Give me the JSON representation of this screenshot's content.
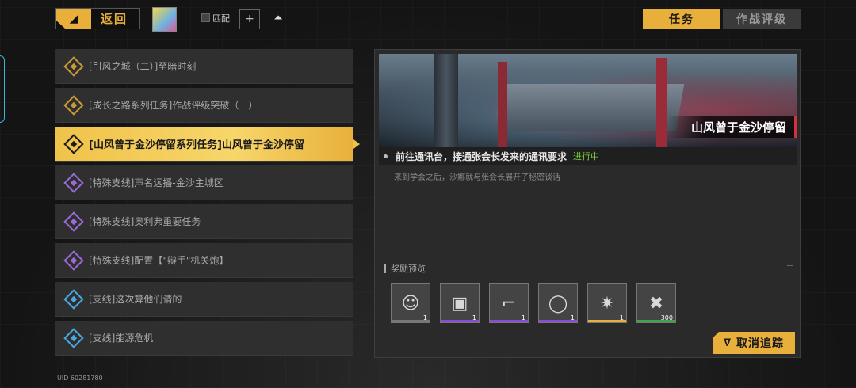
{
  "topbar": {
    "back_label": "返回",
    "back_arrow": "◢",
    "match_label": "匹配",
    "plus_label": "+",
    "up_icon": "⏶"
  },
  "tabs": [
    {
      "label": "任务",
      "active": true
    },
    {
      "label": "作战评级",
      "active": false
    }
  ],
  "quests": [
    {
      "label": "[引风之城（二）]至暗时刻",
      "color": "gold"
    },
    {
      "label": "[成长之路系列任务]作战评级突破（一）",
      "color": "gold"
    },
    {
      "label": "[山风曾于金沙停留系列任务]山风曾于金沙停留",
      "color": "gold",
      "active": true
    },
    {
      "label": "[特殊支线]声名远播-金沙主城区",
      "color": "purple"
    },
    {
      "label": "[特殊支线]奥利弗重要任务",
      "color": "purple"
    },
    {
      "label": "[特殊支线]配置【\"辩手\"机关炮】",
      "color": "purple"
    },
    {
      "label": "[支线]这次算他们请的",
      "color": "blue"
    },
    {
      "label": "[支线]能源危机",
      "color": "blue"
    }
  ],
  "detail": {
    "banner_title": "山风曾于金沙停留",
    "objective": "前往通讯台，接通张会长发来的通讯要求",
    "status": "进行中",
    "description": "来到学会之后，沙娜就与张会长展开了秘密谈话",
    "reward_title": "奖励预览",
    "rewards": [
      {
        "icon": "character-portrait-icon",
        "glyph": "☺",
        "count": "1",
        "rarity": "gray"
      },
      {
        "icon": "device-item-icon",
        "glyph": "▣",
        "count": "1",
        "rarity": "purple"
      },
      {
        "icon": "boot-item-icon",
        "glyph": "⌐",
        "count": "1",
        "rarity": "purple"
      },
      {
        "icon": "bracelet-item-icon",
        "glyph": "◯",
        "count": "1",
        "rarity": "purple"
      },
      {
        "icon": "star-badge-icon",
        "glyph": "✷",
        "count": "1",
        "rarity": "gold"
      },
      {
        "icon": "exp-chip-icon",
        "glyph": "✖",
        "count": "300",
        "rarity": "green"
      }
    ],
    "cancel_label": "取消追踪",
    "cancel_icon": "∇"
  },
  "uid": "UID 60281780"
}
